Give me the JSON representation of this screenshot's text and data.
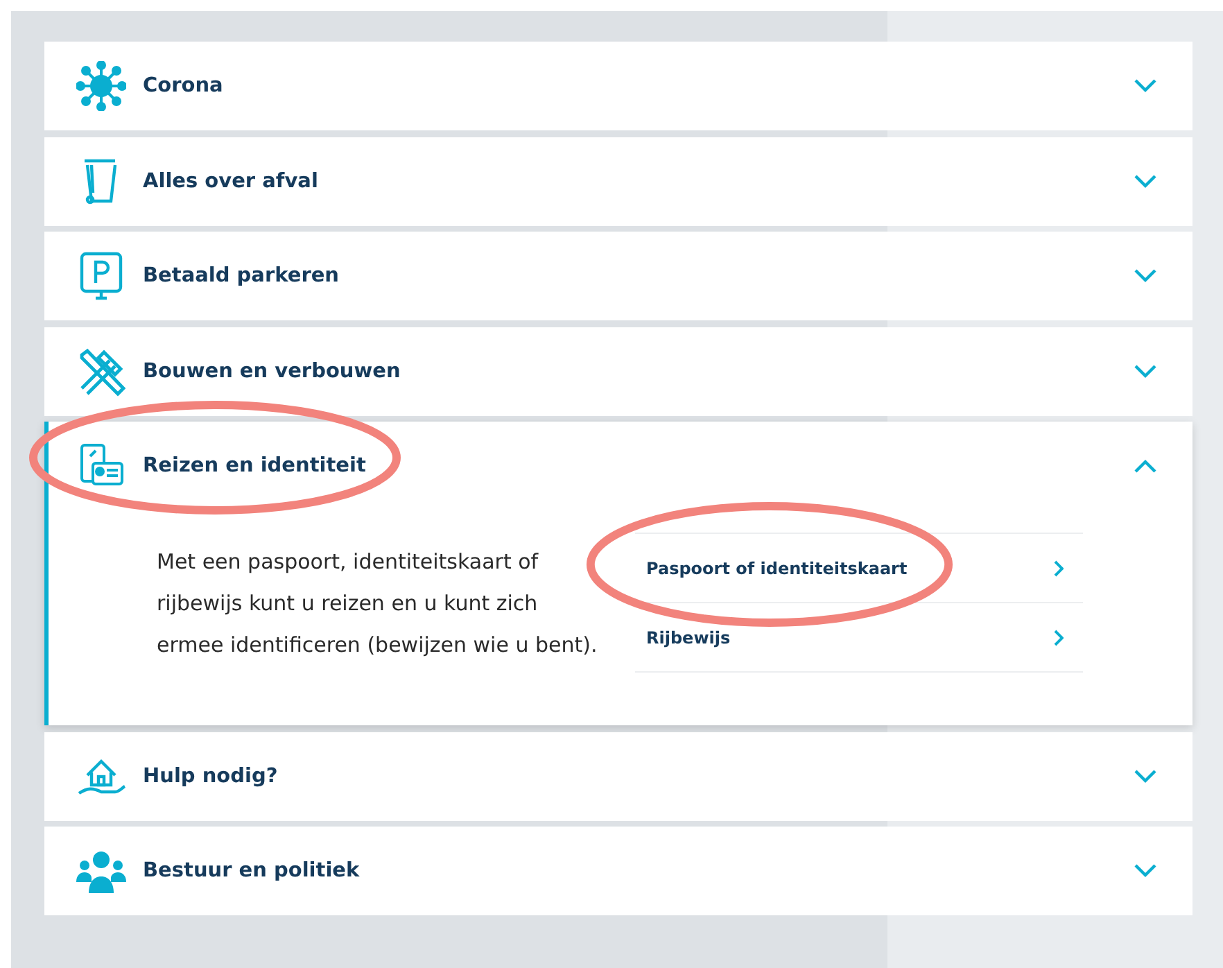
{
  "items": [
    {
      "title": "Corona",
      "kind": "virus",
      "expanded": false,
      "highlighted": false
    },
    {
      "title": "Alles over afval",
      "kind": "bin",
      "expanded": false,
      "highlighted": false
    },
    {
      "title": "Betaald parkeren",
      "kind": "parking",
      "expanded": false,
      "highlighted": false
    },
    {
      "title": "Bouwen en verbouwen",
      "kind": "tools",
      "expanded": false,
      "highlighted": false
    },
    {
      "title": "Reizen en identiteit",
      "kind": "id",
      "expanded": true,
      "highlighted": true,
      "description": "Met een paspoort, identiteitskaart of rijbewijs kunt u reizen en u kunt zich ermee identificeren (bewijzen wie u bent).",
      "links": [
        {
          "label": "Paspoort of identiteitskaart",
          "highlighted": true
        },
        {
          "label": "Rijbewijs",
          "highlighted": false
        }
      ]
    },
    {
      "title": "Hulp nodig?",
      "kind": "house",
      "expanded": false,
      "highlighted": false
    },
    {
      "title": "Bestuur en politiek",
      "kind": "people",
      "expanded": false,
      "highlighted": false
    }
  ]
}
